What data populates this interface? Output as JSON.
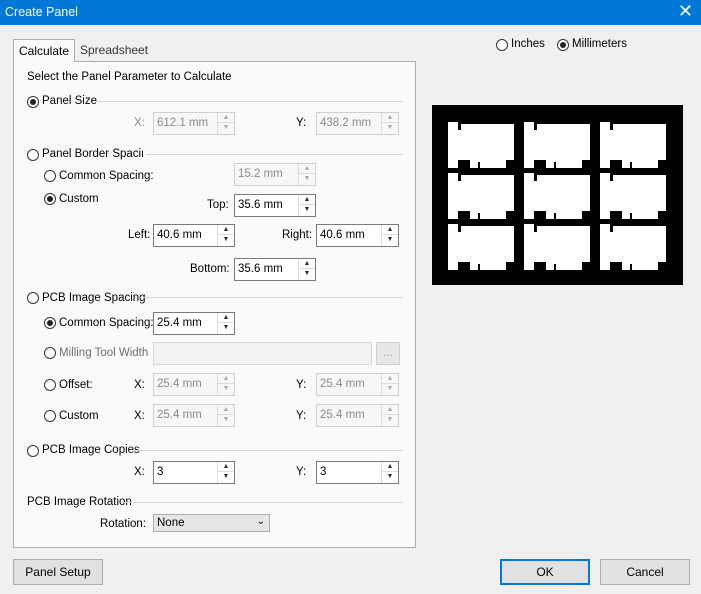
{
  "window": {
    "title": "Create Panel",
    "close_glyph": "✕"
  },
  "tabs": [
    {
      "label": "Calculate"
    },
    {
      "label": "Spreadsheet"
    }
  ],
  "units": {
    "inches_label": "Inches",
    "millimeters_label": "Millimeters",
    "selected": "Millimeters"
  },
  "heading": "Select the Panel Parameter to Calculate",
  "panel_size": {
    "label": "Panel Size",
    "x_label": "X:",
    "x_value": "612.1 mm",
    "y_label": "Y:",
    "y_value": "438.2 mm"
  },
  "border": {
    "label": "Panel Border Spacing",
    "common_label": "Common Spacing:",
    "common_value": "15.2 mm",
    "custom_label": "Custom",
    "top_label": "Top:",
    "top_value": "35.6 mm",
    "left_label": "Left:",
    "left_value": "40.6 mm",
    "right_label": "Right:",
    "right_value": "40.6 mm",
    "bottom_label": "Bottom:",
    "bottom_value": "35.6 mm"
  },
  "image_spacing": {
    "label": "PCB Image Spacing",
    "common_label": "Common Spacing:",
    "common_value": "25.4 mm",
    "milling_label": "Milling Tool Width",
    "milling_value": "",
    "browse_label": "...",
    "offset_label": "Offset:",
    "offset_x_label": "X:",
    "offset_x": "25.4 mm",
    "offset_y_label": "Y:",
    "offset_y": "25.4 mm",
    "custom_label": "Custom",
    "custom_x_label": "X:",
    "custom_x": "25.4 mm",
    "custom_y_label": "Y:",
    "custom_y": "25.4 mm"
  },
  "copies": {
    "label": "PCB Image Copies",
    "x_label": "X:",
    "x_value": "3",
    "y_label": "Y:",
    "y_value": "3"
  },
  "rotation": {
    "section_label": "PCB Image Rotation",
    "label": "Rotation:",
    "value": "None"
  },
  "buttons": {
    "panel_setup": "Panel Setup",
    "ok": "OK",
    "cancel": "Cancel"
  },
  "arrows": {
    "up": "▲",
    "down": "▼",
    "combo": "⌄"
  }
}
